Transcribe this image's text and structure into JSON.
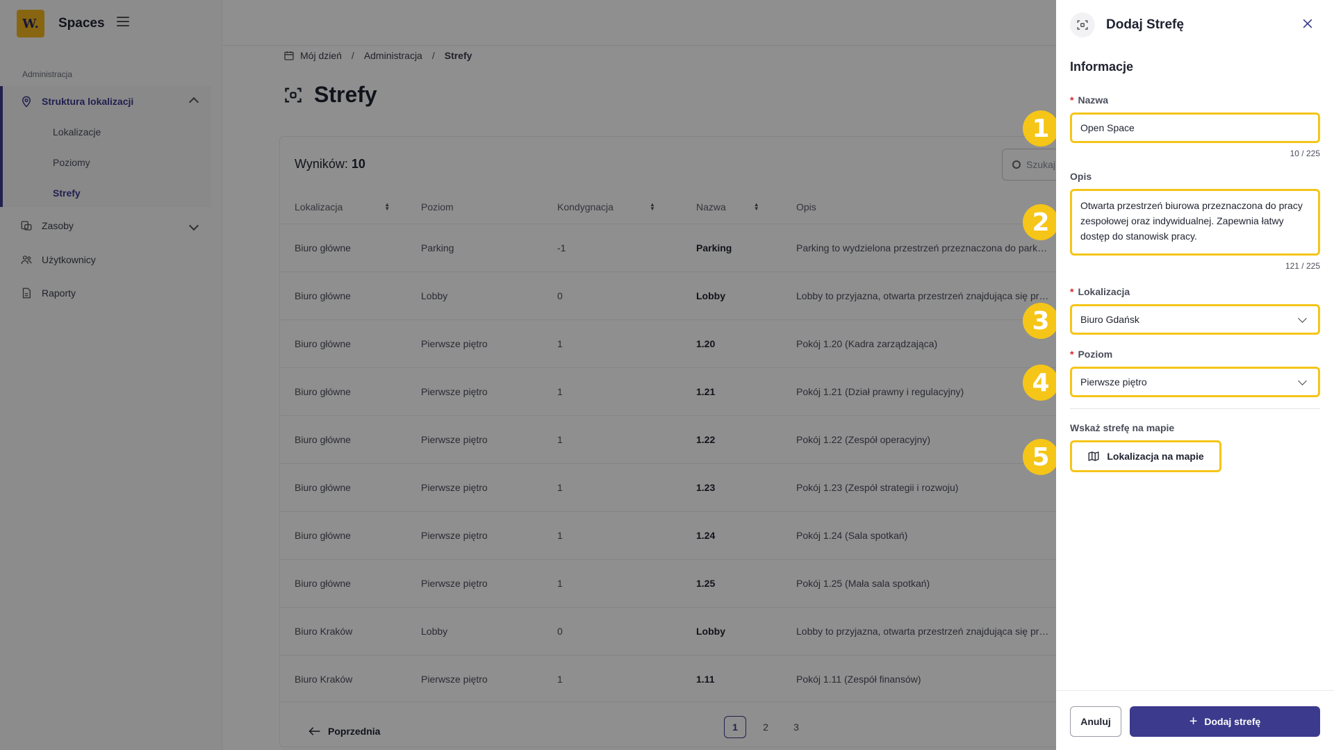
{
  "app": {
    "logo_text": "W.",
    "name": "Spaces"
  },
  "sidebar": {
    "section_label": "Administracja",
    "items": [
      {
        "label": "Struktura lokalizacji",
        "icon": "location-pin-icon",
        "expanded": true,
        "children": [
          {
            "label": "Lokalizacje"
          },
          {
            "label": "Poziomy"
          },
          {
            "label": "Strefy",
            "active": true
          }
        ]
      },
      {
        "label": "Zasoby",
        "icon": "resources-icon",
        "expanded": false
      },
      {
        "label": "Użytkownicy",
        "icon": "users-icon"
      },
      {
        "label": "Raporty",
        "icon": "report-icon"
      }
    ]
  },
  "breadcrumb": [
    "Mój dzień",
    "Administracja",
    "Strefy"
  ],
  "page": {
    "title": "Strefy",
    "results_label": "Wyników:",
    "results_count": "10",
    "search_placeholder": "Szukaj"
  },
  "table": {
    "columns": [
      "Lokalizacja",
      "Poziom",
      "Kondygnacja",
      "Nazwa",
      "Opis"
    ],
    "rows": [
      [
        "Biuro główne",
        "Parking",
        "-1",
        "Parking",
        "Parking to wydzielona przestrzeń przeznaczona do park…"
      ],
      [
        "Biuro główne",
        "Lobby",
        "0",
        "Lobby",
        "Lobby to przyjazna, otwarta przestrzeń znajdująca się pr…"
      ],
      [
        "Biuro główne",
        "Pierwsze piętro",
        "1",
        "1.20",
        "Pokój 1.20 (Kadra zarządzająca)"
      ],
      [
        "Biuro główne",
        "Pierwsze piętro",
        "1",
        "1.21",
        "Pokój 1.21 (Dział prawny i regulacyjny)"
      ],
      [
        "Biuro główne",
        "Pierwsze piętro",
        "1",
        "1.22",
        "Pokój 1.22 (Zespół operacyjny)"
      ],
      [
        "Biuro główne",
        "Pierwsze piętro",
        "1",
        "1.23",
        "Pokój 1.23 (Zespół strategii i rozwoju)"
      ],
      [
        "Biuro główne",
        "Pierwsze piętro",
        "1",
        "1.24",
        "Pokój 1.24 (Sala spotkań)"
      ],
      [
        "Biuro główne",
        "Pierwsze piętro",
        "1",
        "1.25",
        "Pokój 1.25 (Mała sala spotkań)"
      ],
      [
        "Biuro Kraków",
        "Lobby",
        "0",
        "Lobby",
        "Lobby to przyjazna, otwarta przestrzeń znajdująca się pr…"
      ],
      [
        "Biuro Kraków",
        "Pierwsze piętro",
        "1",
        "1.11",
        "Pokój 1.11 (Zespół finansów)"
      ]
    ]
  },
  "pagination": {
    "prev_label": "Poprzednia",
    "pages": [
      "1",
      "2",
      "3"
    ],
    "current": "1"
  },
  "drawer": {
    "title": "Dodaj Strefę",
    "section": "Informacje",
    "name_label": "Nazwa",
    "name_value": "Open Space",
    "name_counter": "10 / 225",
    "desc_label": "Opis",
    "desc_value": "Otwarta przestrzeń biurowa przeznaczona do pracy zespołowej oraz indywidualnej. Zapewnia łatwy dostęp do stanowisk pracy.",
    "desc_counter": "121 / 225",
    "location_label": "Lokalizacja",
    "location_value": "Biuro Gdańsk",
    "level_label": "Poziom",
    "level_value": "Pierwsze piętro",
    "map_section_label": "Wskaż strefę na mapie",
    "map_button_label": "Lokalizacja na mapie",
    "cancel_label": "Anuluj",
    "submit_label": "Dodaj strefę",
    "required_mark": "*"
  },
  "steps": [
    "1",
    "2",
    "3",
    "4",
    "5"
  ],
  "colors": {
    "accent": "#3b3a8c",
    "highlight": "#f5c518",
    "logo": "#f2b71f",
    "required": "#d9262d"
  }
}
